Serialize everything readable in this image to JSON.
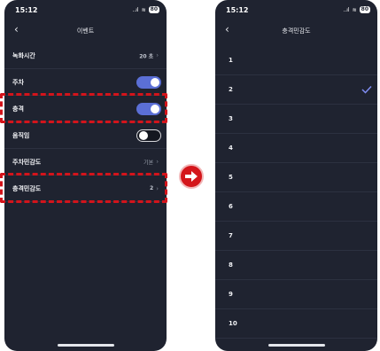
{
  "left_screen": {
    "status": {
      "time": "15:12",
      "signal": "..ıl",
      "wifi": "≋",
      "battery": "80"
    },
    "nav": {
      "back": "‹",
      "title": "이벤트"
    },
    "rows": [
      {
        "label": "녹화시간",
        "value": "20 초",
        "chevron": "›"
      },
      {
        "label": "주차",
        "toggle": true
      },
      {
        "label": "충격",
        "toggle": true
      },
      {
        "label": "움직임",
        "toggle": false
      },
      {
        "label": "주차민감도",
        "value": "기본",
        "chevron": "›"
      },
      {
        "label": "충격민감도",
        "value": "2",
        "chevron": "›"
      }
    ]
  },
  "right_screen": {
    "status": {
      "time": "15:12",
      "signal": "..ıl",
      "wifi": "≋",
      "battery": "80"
    },
    "nav": {
      "back": "‹",
      "title": "충격민감도"
    },
    "options": [
      "1",
      "2",
      "3",
      "4",
      "5",
      "6",
      "7",
      "8",
      "9",
      "10"
    ],
    "selected": "2"
  },
  "colors": {
    "toggle_on": "#5b6fd6",
    "highlight": "#d3141b",
    "background": "#1f2330"
  },
  "icons": {
    "arrow": "right-arrow-icon",
    "check": "check-icon"
  }
}
